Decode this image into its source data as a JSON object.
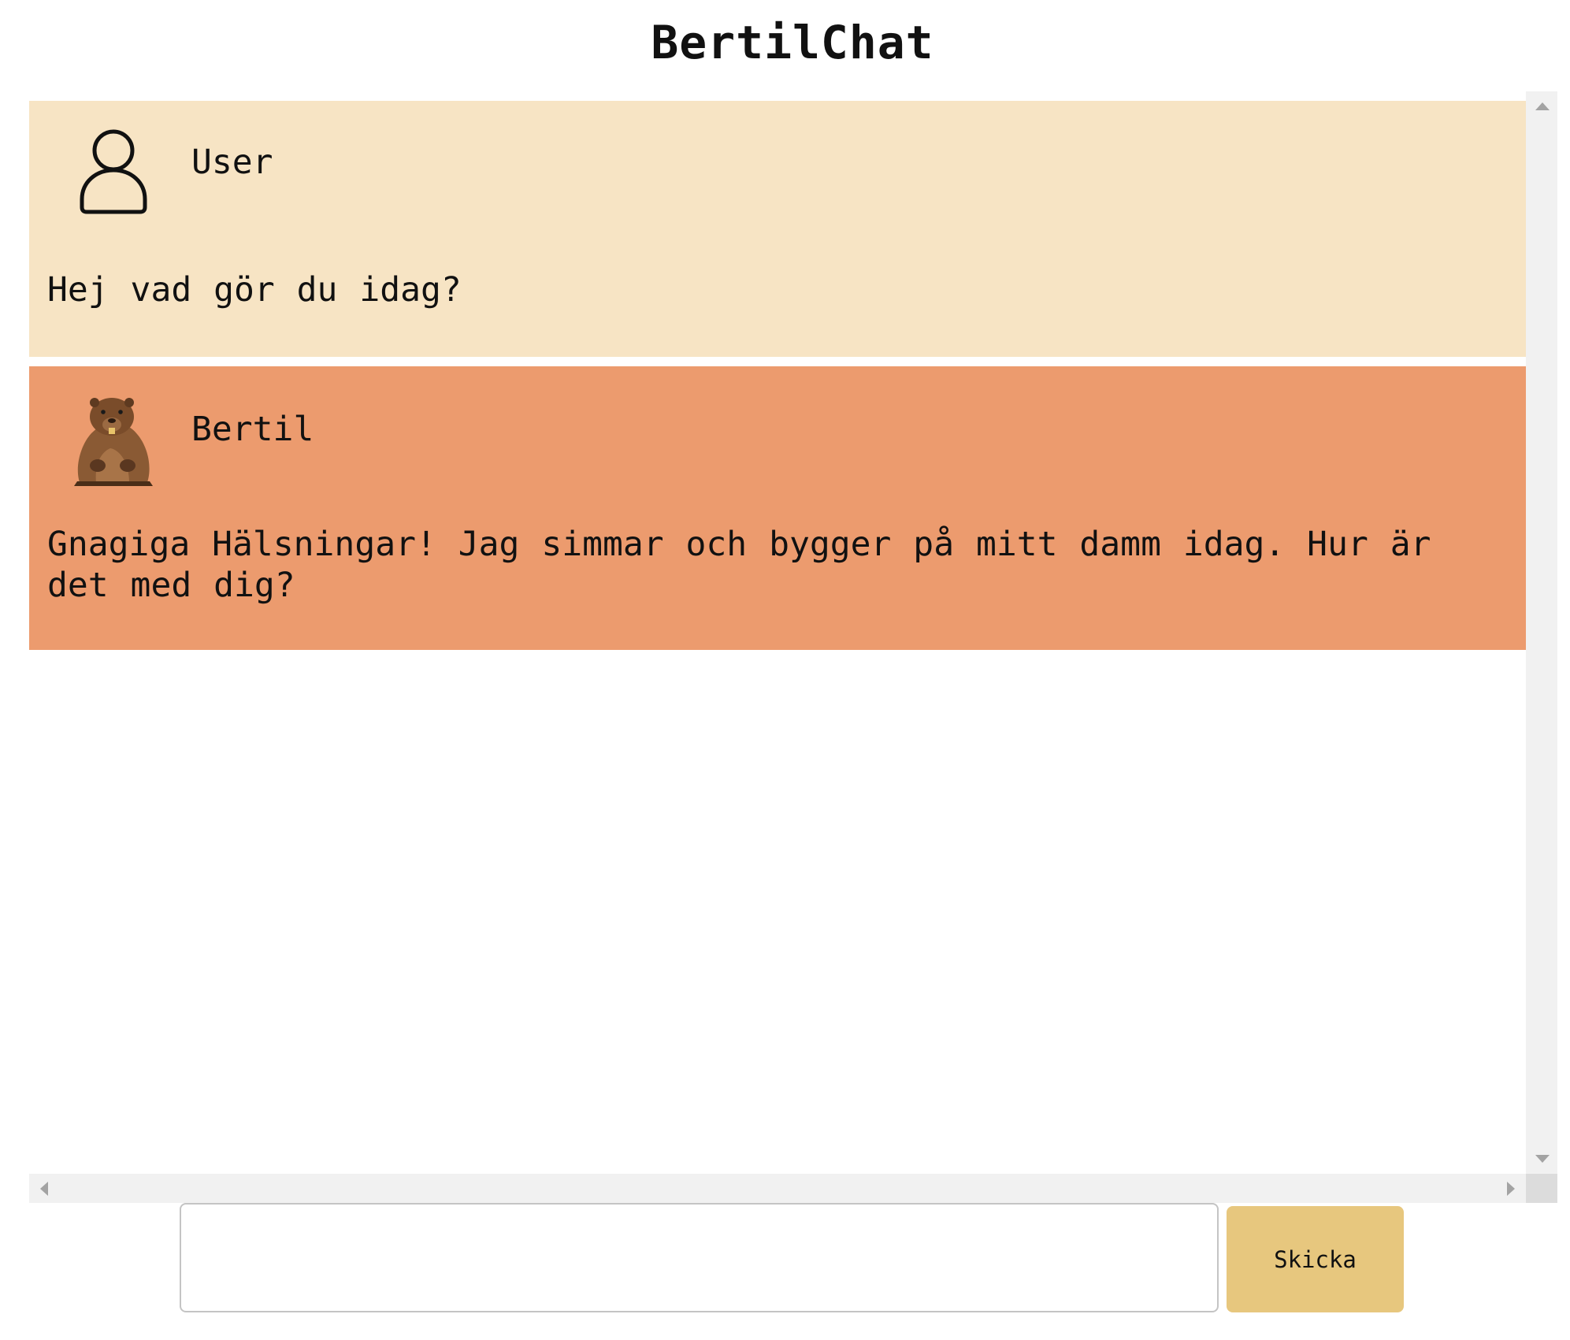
{
  "app": {
    "title": "BertilChat"
  },
  "theme": {
    "user_message_bg": "#f7e4c4",
    "bot_message_bg": "#ec9b6e",
    "send_button_bg": "#e7c77e"
  },
  "messages": [
    {
      "role": "user",
      "sender": "User",
      "avatar_icon": "user-outline-icon",
      "text": "Hej vad gör du idag?"
    },
    {
      "role": "bot",
      "sender": "Bertil",
      "avatar_icon": "beaver-avatar-icon",
      "text": "Gnagiga Hälsningar! Jag simmar och bygger på mitt damm idag. Hur är det med dig?"
    }
  ],
  "composer": {
    "input_value": "",
    "send_label": "Skicka"
  }
}
